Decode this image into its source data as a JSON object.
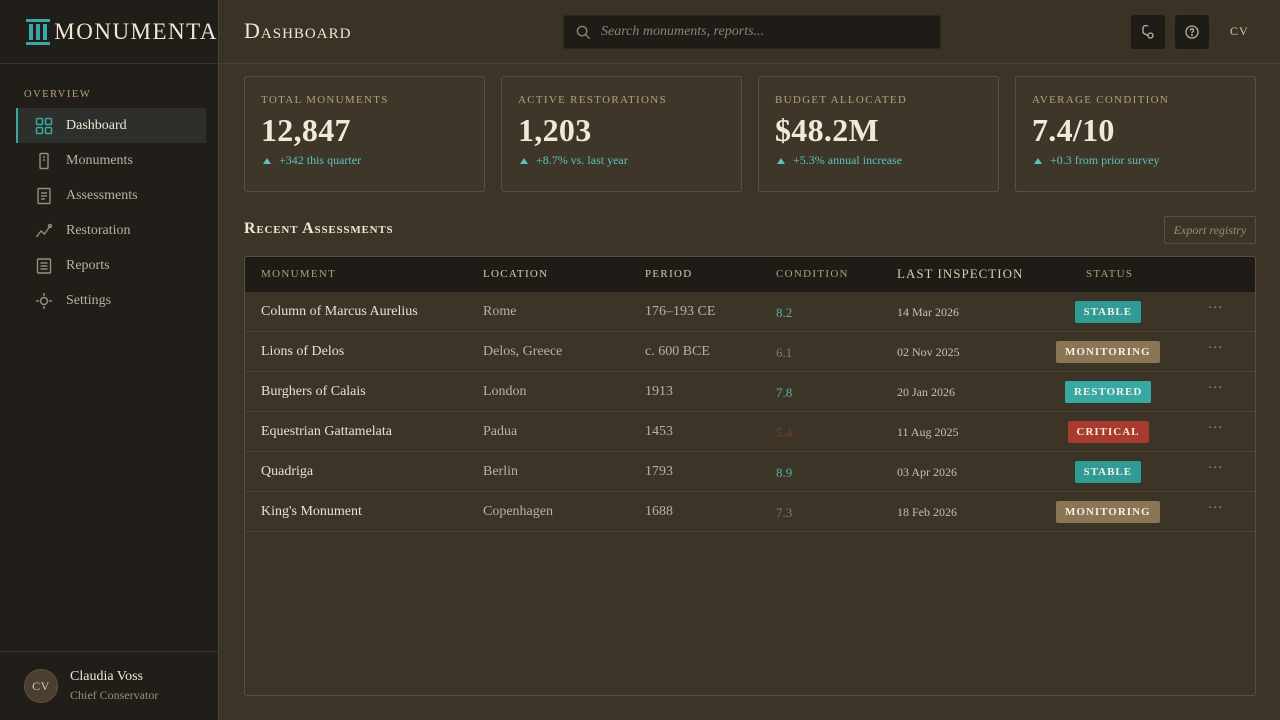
{
  "app": {
    "brand": "MONUMENTA",
    "page_title": "Dashboard",
    "header_initials": "CV"
  },
  "colors": {
    "accent": "#3aa7a3",
    "trend": "#58c3bd",
    "stable": "#2f9a96",
    "monitoring": "#8a7555",
    "restored": "#36a9a5",
    "critical": "#a93a30"
  },
  "search": {
    "placeholder": "Search monuments, reports..."
  },
  "sidebar": {
    "section": "Overview",
    "items": [
      {
        "label": "Dashboard",
        "icon": "grid-icon",
        "active": true
      },
      {
        "label": "Monuments",
        "icon": "monument-icon"
      },
      {
        "label": "Assessments",
        "icon": "document-icon"
      },
      {
        "label": "Restoration",
        "icon": "trend-icon"
      },
      {
        "label": "Reports",
        "icon": "report-icon"
      },
      {
        "label": "Settings",
        "icon": "gear-icon"
      }
    ],
    "user": {
      "initials": "CV",
      "name": "Claudia Voss",
      "role": "Chief Conservator"
    }
  },
  "stats": [
    {
      "label": "Total Monuments",
      "value": "12,847",
      "trend": "+342 this quarter"
    },
    {
      "label": "Active Restorations",
      "value": "1,203",
      "trend": "+8.7% vs. last year"
    },
    {
      "label": "Budget Allocated",
      "value": "$48.2M",
      "trend": "+5.3% annual increase"
    },
    {
      "label": "Average Condition",
      "value": "7.4/10",
      "trend": "+0.3 from prior survey"
    }
  ],
  "assessments": {
    "title": "Recent Assessments",
    "export_label": "Export registry",
    "columns": [
      "Monument",
      "Location",
      "Period",
      "Condition",
      "Last Inspection",
      "Status"
    ],
    "rows": [
      {
        "monument": "Column of Marcus Aurelius",
        "location": "Rome",
        "period": "176–193 CE",
        "condition": "8.2",
        "inspection": "14 Mar 2026",
        "status": "Stable",
        "status_key": "stable"
      },
      {
        "monument": "Lions of Delos",
        "location": "Delos, Greece",
        "period": "c. 600 BCE",
        "condition": "6.1",
        "inspection": "02 Nov 2025",
        "status": "Monitoring",
        "status_key": "monitoring"
      },
      {
        "monument": "Burghers of Calais",
        "location": "London",
        "period": "1913",
        "condition": "7.8",
        "inspection": "20 Jan 2026",
        "status": "Restored",
        "status_key": "restored"
      },
      {
        "monument": "Equestrian Gattamelata",
        "location": "Padua",
        "period": "1453",
        "condition": "5.4",
        "inspection": "11 Aug 2025",
        "status": "Critical",
        "status_key": "critical"
      },
      {
        "monument": "Quadriga",
        "location": "Berlin",
        "period": "1793",
        "condition": "8.9",
        "inspection": "03 Apr 2026",
        "status": "Stable",
        "status_key": "stable"
      },
      {
        "monument": "King's Monument",
        "location": "Copenhagen",
        "period": "1688",
        "condition": "7.3",
        "inspection": "18 Feb 2026",
        "status": "Monitoring",
        "status_key": "monitoring"
      }
    ],
    "row_action": "···"
  }
}
